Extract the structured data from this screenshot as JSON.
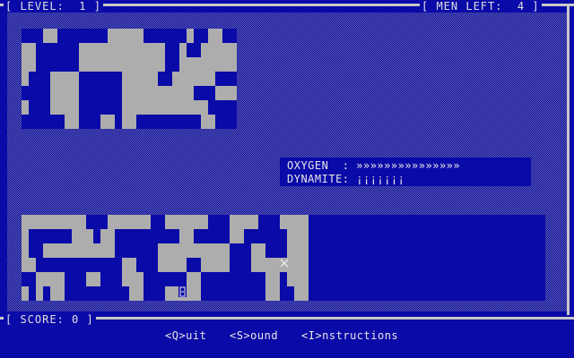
{
  "hud": {
    "level_text": "[ LEVEL:  1 ]",
    "men_text": "[ MEN LEFT:  4 ]",
    "score_text": "[ SCORE: 0 ]"
  },
  "status": {
    "oxygen_text": "OXYGEN  : »»»»»»»»»»»»»»»",
    "dynamite_text": "DYNAMITE: ¡¡¡¡¡¡¡"
  },
  "menu": {
    "quit": "<Q>uit",
    "sound": "<S>ound",
    "instructions": "<I>nstructions"
  },
  "markers": {
    "player_icon": "x-cross-icon",
    "miner_icon": "miner-icon"
  },
  "colors": {
    "background": "#0A0AA8",
    "rock": "#ADADAD",
    "text": "#E8E8E8"
  }
}
